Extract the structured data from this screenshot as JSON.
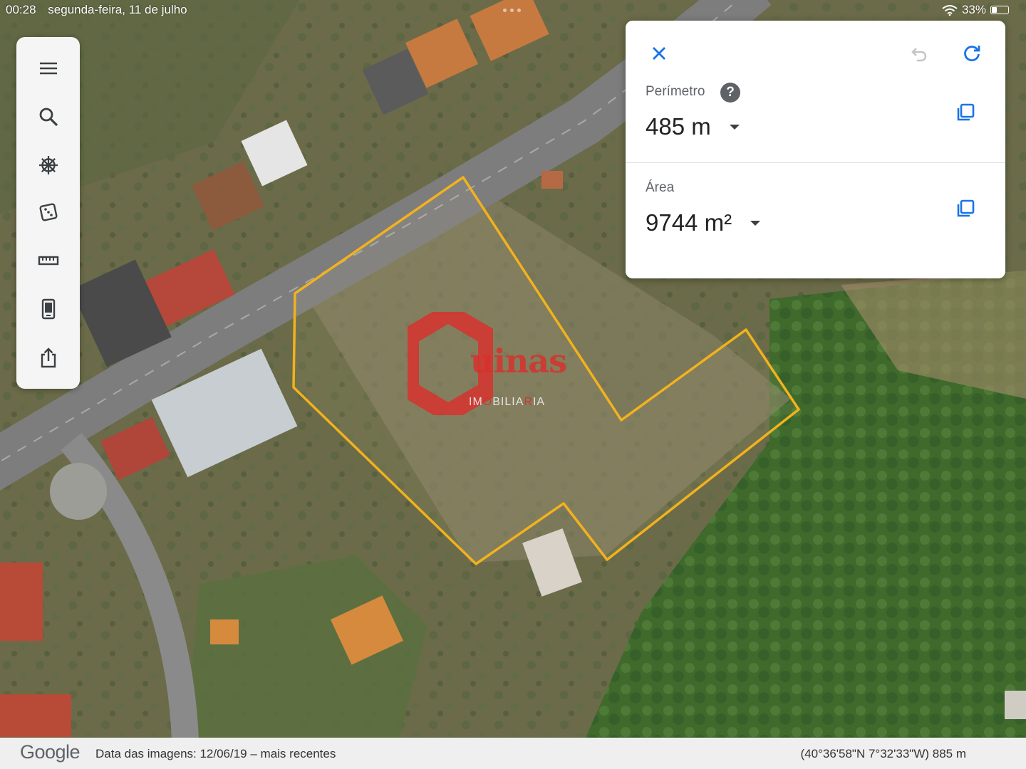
{
  "status_bar": {
    "time": "00:28",
    "date": "segunda-feira, 11 de julho",
    "battery": "33%",
    "battery_level": 0.33,
    "wifi_icon": "wifi-icon"
  },
  "toolbar": {
    "items": [
      {
        "name": "menu-icon"
      },
      {
        "name": "search-icon"
      },
      {
        "name": "voyager-wheel-icon"
      },
      {
        "name": "random-dice-icon"
      },
      {
        "name": "measure-ruler-icon"
      },
      {
        "name": "projects-icon"
      },
      {
        "name": "share-icon"
      }
    ]
  },
  "measure_panel": {
    "perimeter_label": "Perímetro",
    "perimeter_value": "485 m",
    "area_label": "Área",
    "area_value": "9744 m²",
    "help_glyph": "?",
    "accent_color": "#1a73e8"
  },
  "watermark": {
    "brand": "uinas",
    "subtitle_a": "IM",
    "subtitle_o": "O",
    "subtitle_b": "BILIA",
    "subtitle_r": "R",
    "subtitle_c": "IA",
    "brand_color": "#d9302c"
  },
  "overlay": {
    "polygon_color": "#f2b21d"
  },
  "bottom_bar": {
    "logo": "Google",
    "imagery_date": "Data das imagens: 12/06/19 – mais recentes",
    "coordinates": "(40°36'58\"N 7°32'33\"W) 885 m"
  }
}
